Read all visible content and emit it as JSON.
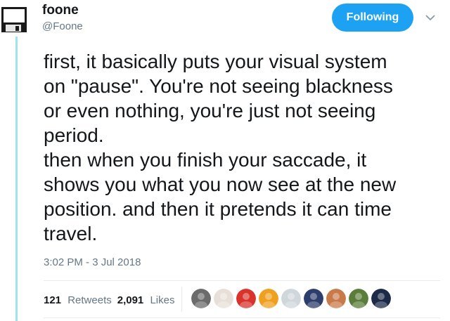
{
  "author": {
    "name": "foone",
    "handle": "@Foone",
    "avatar_icon": "floppy-disk-icon"
  },
  "follow_button": {
    "label": "Following",
    "color": "#1da1f2"
  },
  "menu_icon": "chevron-down-icon",
  "tweet": {
    "text": "first, it basically puts your visual system\non \"pause\". You're not seeing blackness\nor even nothing, you're just not seeing\nperiod.\nthen when you finish your saccade, it\nshows you what you now see at the new\nposition. and then it pretends it can time\ntravel.",
    "timestamp": "3:02 PM - 3 Jul 2018"
  },
  "stats": {
    "retweets_count": "121",
    "retweets_label": "Retweets",
    "likes_count": "2,091",
    "likes_label": "Likes"
  },
  "likers": [
    {
      "name": "liker-avatar-1",
      "color": "#6b6b6b"
    },
    {
      "name": "liker-avatar-2",
      "color": "#e8e0d8"
    },
    {
      "name": "liker-avatar-3",
      "color": "#d9332c"
    },
    {
      "name": "liker-avatar-4",
      "color": "#f0a020"
    },
    {
      "name": "liker-avatar-5",
      "color": "#cfd6dc"
    },
    {
      "name": "liker-avatar-6",
      "color": "#2c3e6b"
    },
    {
      "name": "liker-avatar-7",
      "color": "#c97a4a"
    },
    {
      "name": "liker-avatar-8",
      "color": "#5a7d3a"
    },
    {
      "name": "liker-avatar-9",
      "color": "#1c2a48"
    }
  ],
  "colors": {
    "accent": "#1da1f2",
    "thread_line": "#9ee3f2",
    "secondary_text": "#657786"
  }
}
